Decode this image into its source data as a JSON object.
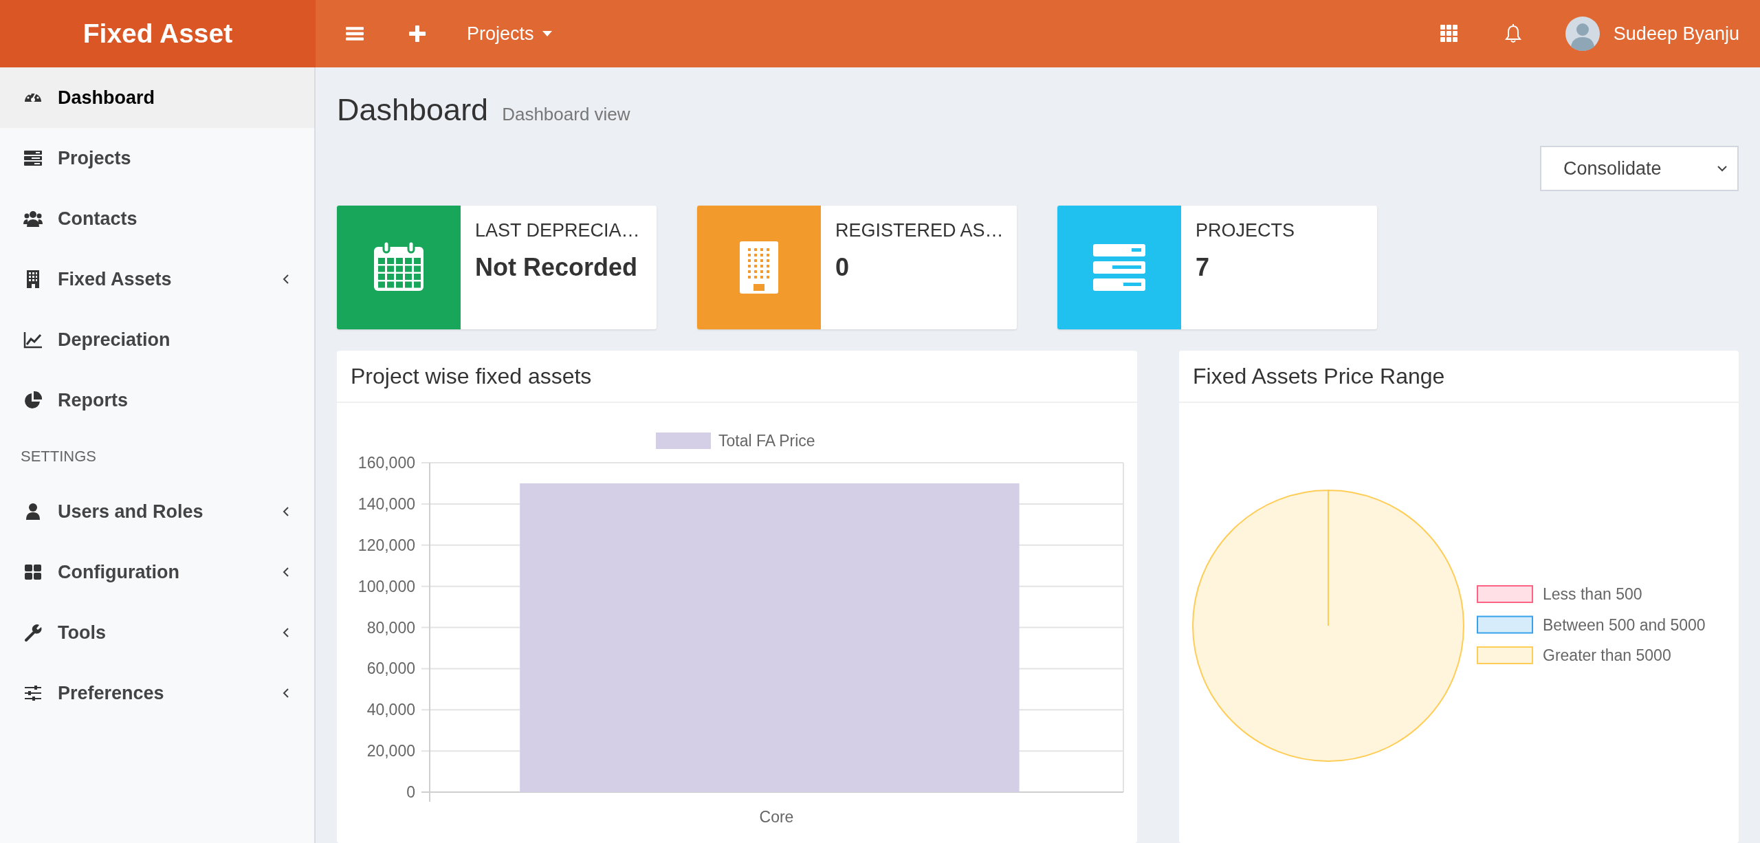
{
  "header": {
    "brand": "Fixed Asset",
    "nav_menu": "Projects",
    "user_name": "Sudeep Byanju"
  },
  "sidebar": {
    "items": [
      {
        "kind": "link",
        "label": "Dashboard",
        "selected": true,
        "expandable": false
      },
      {
        "kind": "link",
        "label": "Projects",
        "selected": false,
        "expandable": false
      },
      {
        "kind": "link",
        "label": "Contacts",
        "selected": false,
        "expandable": false
      },
      {
        "kind": "link",
        "label": "Fixed Assets",
        "selected": false,
        "expandable": true
      },
      {
        "kind": "link",
        "label": "Depreciation",
        "selected": false,
        "expandable": false
      },
      {
        "kind": "link",
        "label": "Reports",
        "selected": false,
        "expandable": false
      },
      {
        "kind": "heading",
        "label": "SETTINGS"
      },
      {
        "kind": "link",
        "label": "Users and Roles",
        "selected": false,
        "expandable": true
      },
      {
        "kind": "link",
        "label": "Configuration",
        "selected": false,
        "expandable": true
      },
      {
        "kind": "link",
        "label": "Tools",
        "selected": false,
        "expandable": true
      },
      {
        "kind": "link",
        "label": "Preferences",
        "selected": false,
        "expandable": true
      }
    ]
  },
  "page": {
    "title": "Dashboard",
    "subtitle": "Dashboard view"
  },
  "scope_select": {
    "value": "Consolidate"
  },
  "info_boxes": [
    {
      "label": "LAST DEPRECIA…",
      "value": "Not Recorded",
      "color": "#18a65b"
    },
    {
      "label": "REGISTERED AS…",
      "value": "0",
      "color": "#f29b2c"
    },
    {
      "label": "PROJECTS",
      "value": "7",
      "color": "#20c1ee"
    }
  ],
  "panels": [
    {
      "title": "Project wise fixed assets",
      "chart_data": {
        "type": "bar",
        "grid": true,
        "categories": [
          "Core"
        ],
        "series": [
          {
            "name": "Total FA Price",
            "color": "#d4cfe6",
            "values": [
              150000
            ]
          }
        ],
        "ylim": [
          0,
          160000
        ],
        "yticks": [
          {
            "value": 0,
            "label": "0"
          },
          {
            "value": 20000,
            "label": "20,000"
          },
          {
            "value": 40000,
            "label": "40,000"
          },
          {
            "value": 60000,
            "label": "60,000"
          },
          {
            "value": 80000,
            "label": "80,000"
          },
          {
            "value": 100000,
            "label": "100,000"
          },
          {
            "value": 120000,
            "label": "120,000"
          },
          {
            "value": 140000,
            "label": "140,000"
          },
          {
            "value": 160000,
            "label": "160,000"
          }
        ]
      }
    },
    {
      "title": "Fixed Assets Price Range",
      "chart_data": {
        "type": "pie",
        "categories": [
          "Less than 500",
          "Between 500 and 5000",
          "Greater than 5000"
        ],
        "values": [
          0,
          0,
          1
        ],
        "colors": [
          "#ff6384",
          "#36a2eb",
          "#ffcd56"
        ]
      }
    }
  ]
}
